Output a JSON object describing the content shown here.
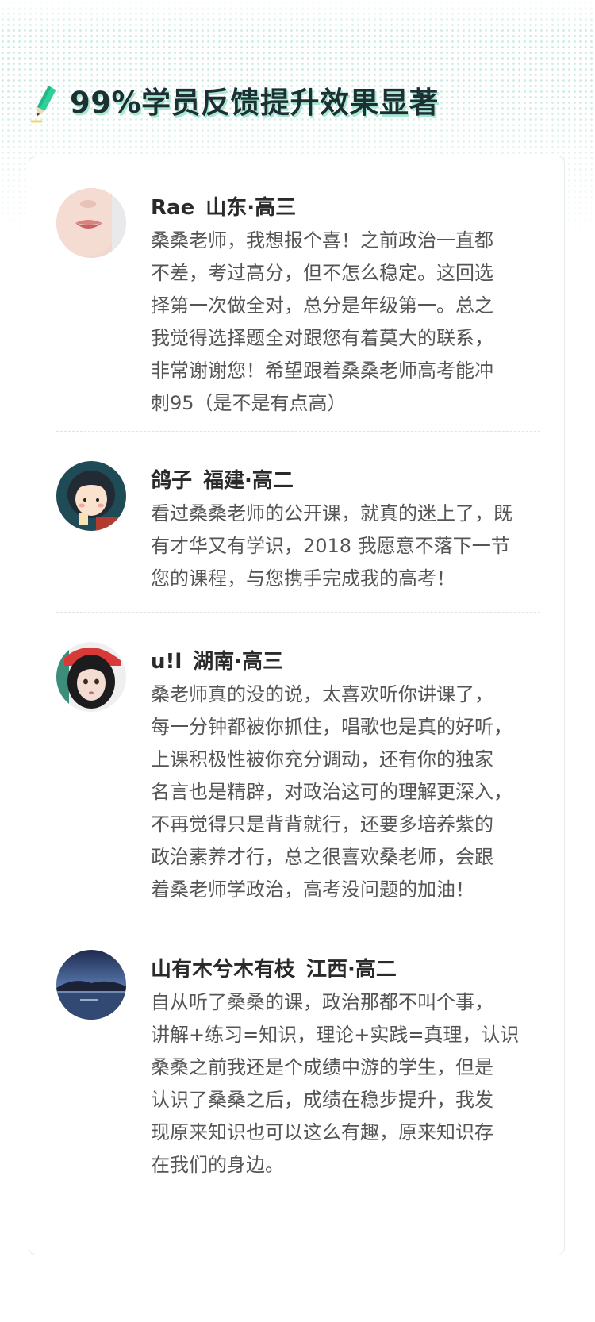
{
  "header": {
    "title": "99%学员反馈提升效果显著",
    "icon": "pencil-icon",
    "accent_color": "#2fcf9c"
  },
  "reviews": [
    {
      "name": "Rae",
      "location": "山东·高三",
      "avatar": "avatar-lips",
      "lines": [
        "桑桑老师，我想报个喜！之前政治一直都",
        "不差，考过高分，但不怎么稳定。这回选",
        "择第一次做全对，总分是年级第一。总之",
        "我觉得选择题全对跟您有着莫大的联系，",
        "非常谢谢您！希望跟着桑桑老师高考能冲",
        "刺95（是不是有点高）"
      ]
    },
    {
      "name": "鸽子",
      "location": "福建·高二",
      "avatar": "avatar-cartoon-girl",
      "lines": [
        "看过桑桑老师的公开课，就真的迷上了，既",
        "有才华又有学识，2018 我愿意不落下一节",
        "您的课程，与您携手完成我的高考！"
      ]
    },
    {
      "name": "u!l",
      "location": "湖南·高三",
      "avatar": "avatar-doll-girl",
      "lines": [
        "桑老师真的没的说，太喜欢听你讲课了，",
        "每一分钟都被你抓住，唱歌也是真的好听，",
        "上课积极性被你充分调动，还有你的独家",
        "名言也是精辟，对政治这可的理解更深入，",
        "不再觉得只是背背就行，还要多培养紫的",
        "政治素养才行，总之很喜欢桑老师，会跟",
        "着桑老师学政治，高考没问题的加油！"
      ]
    },
    {
      "name": "山有木兮木有枝",
      "location": "江西·高二",
      "avatar": "avatar-lake-landscape",
      "lines": [
        "自从听了桑桑的课，政治那都不叫个事，",
        "讲解+练习=知识，理论+实践=真理，认识",
        "桑桑之前我还是个成绩中游的学生，但是",
        "认识了桑桑之后，成绩在稳步提升，我发",
        "现原来知识也可以这么有趣，原来知识存",
        "在我们的身边。"
      ]
    }
  ]
}
